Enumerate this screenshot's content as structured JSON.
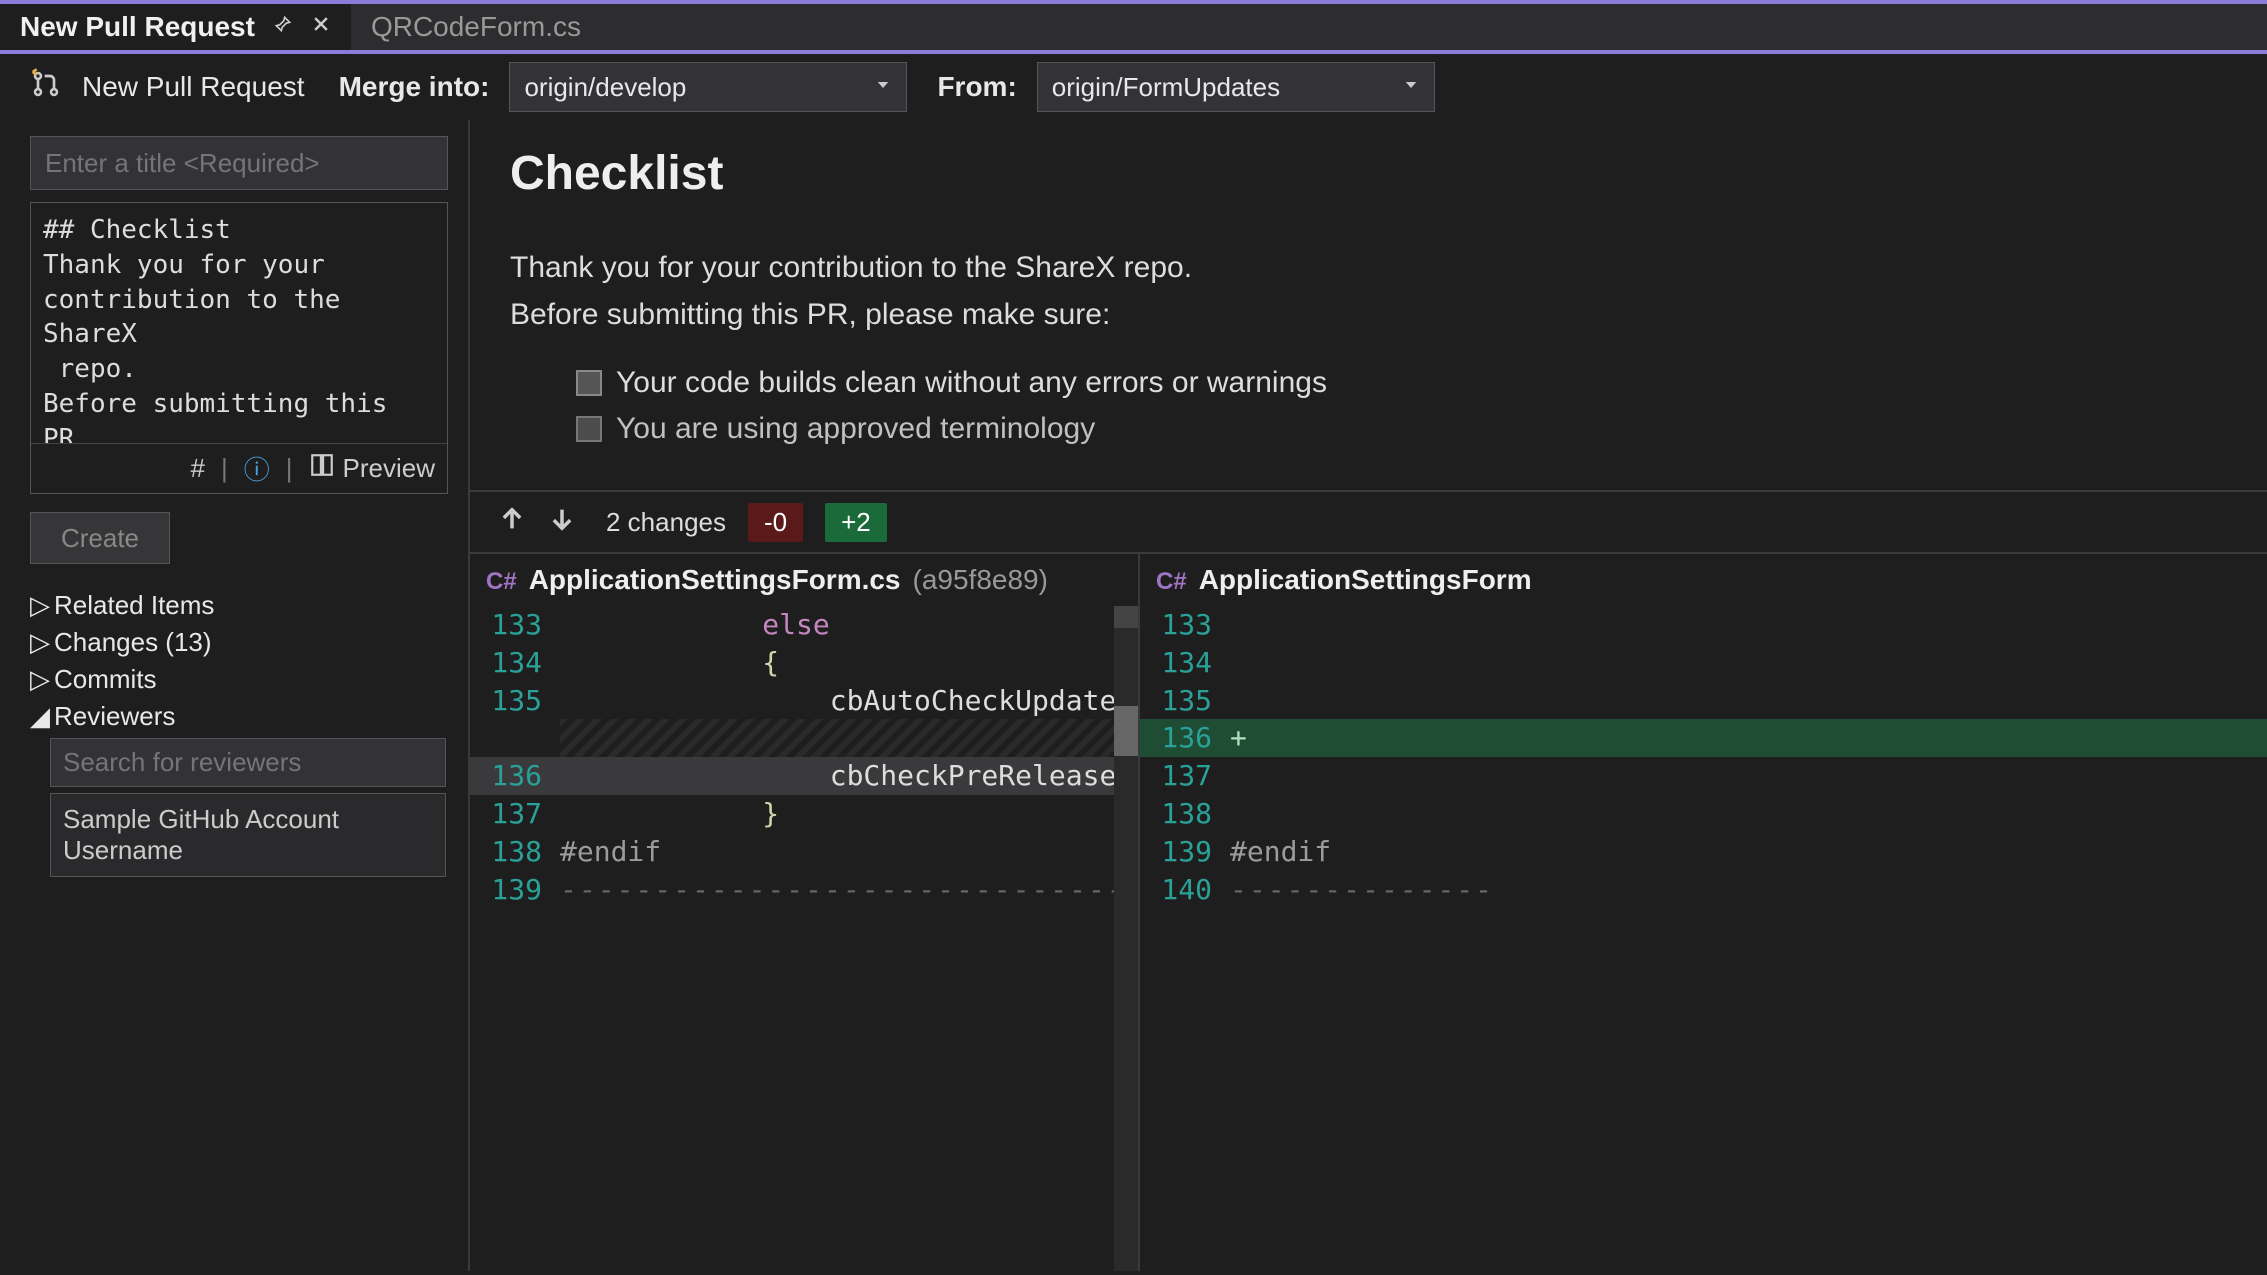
{
  "tabs": {
    "active_label": "New Pull Request",
    "inactive_label": "QRCodeForm.cs"
  },
  "toolbar": {
    "title": "New Pull Request",
    "merge_label": "Merge into:",
    "merge_value": "origin/develop",
    "from_label": "From:",
    "from_value": "origin/FormUpdates"
  },
  "form": {
    "title_placeholder": "Enter a title <Required>",
    "description_text": "## Checklist\nThank you for your contribution to the ShareX\n repo.\nBefore submitting this PR,\n please make sure:\n\n- [x] Your code builds",
    "hash_icon": "#",
    "preview_label": "Preview",
    "create_label": "Create"
  },
  "tree": {
    "related_items": "Related Items",
    "changes": "Changes (13)",
    "commits": "Commits",
    "reviewers": "Reviewers",
    "reviewer_search_placeholder": "Search for reviewers",
    "reviewer_name": "Sample GitHub Account Username"
  },
  "preview": {
    "heading": "Checklist",
    "paragraph1": "Thank you for your contribution to the ShareX repo.",
    "paragraph2": "Before submitting this PR, please make sure:",
    "check1": "Your code builds clean without any errors or warnings",
    "check2": "You are using approved terminology"
  },
  "diff": {
    "changes_label": "2 changes",
    "minus": "-0",
    "plus": "+2",
    "file_lang": "C#",
    "file_name": "ApplicationSettingsForm.cs",
    "file_hash": "(a95f8e89)",
    "file_name_right": "ApplicationSettingsForm",
    "left": {
      "l133": "133",
      "c133": "else",
      "l134": "134",
      "c134": "{",
      "l135": "135",
      "c135": "cbAutoCheckUpdate.(",
      "l136": "136",
      "c136": "cbCheckPreReleaseU",
      "l137": "137",
      "c137": "}",
      "l138": "138",
      "c138": "#endif",
      "l139": "139",
      "c139": "-----------------------------------------"
    },
    "right": {
      "l133": "133",
      "l134": "134",
      "l135": "135",
      "l136": "136",
      "plus136": "+",
      "l137": "137",
      "l138": "138",
      "l139": "139",
      "c139": "#endif",
      "l140": "140",
      "c140": "--------------"
    }
  }
}
